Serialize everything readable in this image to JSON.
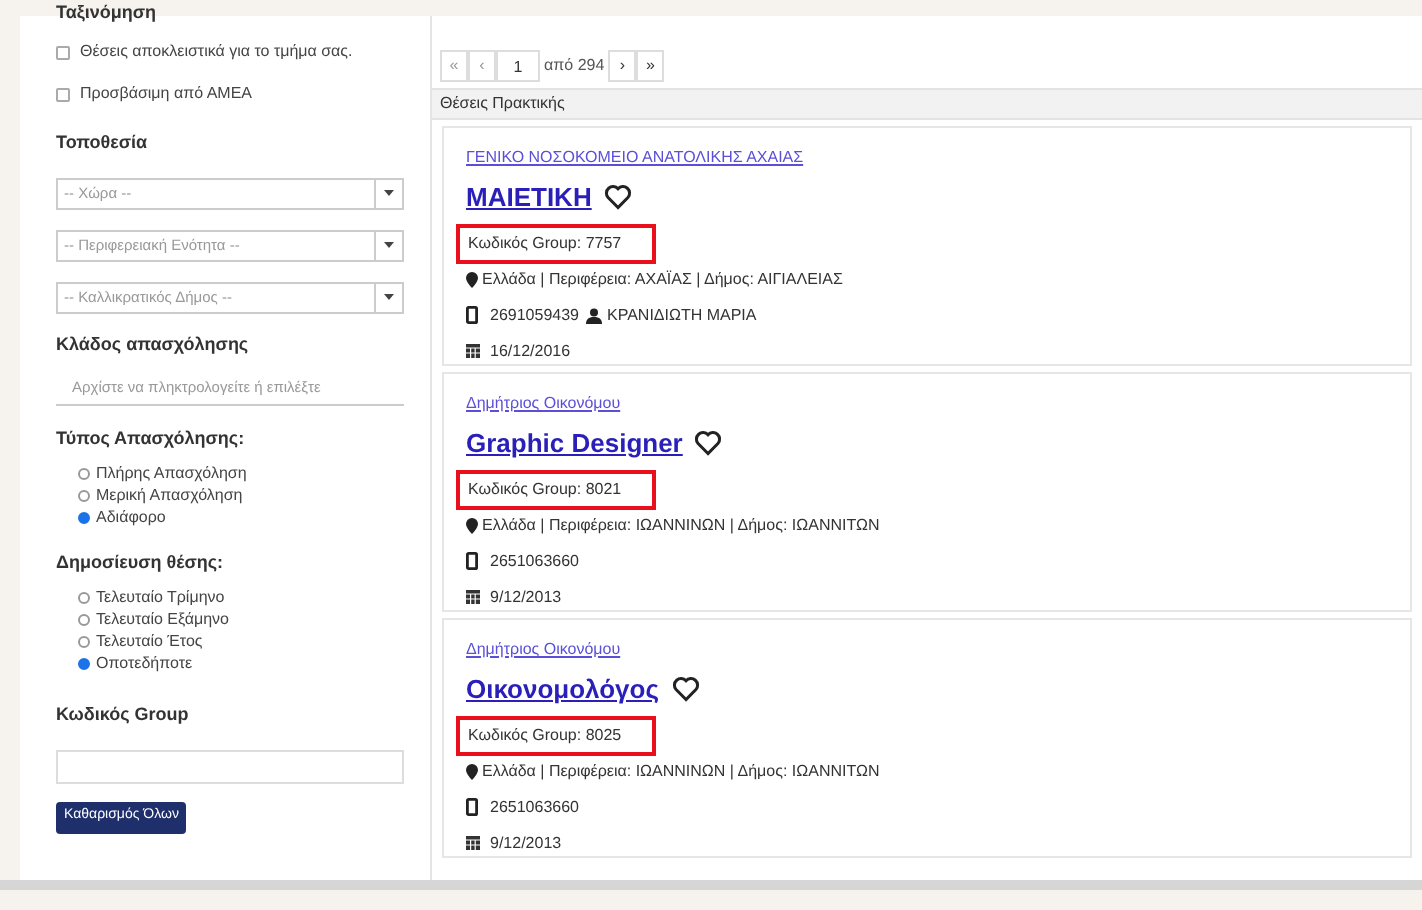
{
  "sidebar": {
    "sort_heading": "Ταξινόμηση",
    "checkboxes": [
      {
        "label": "Θέσεις αποκλειστικά για το τμήμα σας.",
        "checked": false
      },
      {
        "label": "Προσβάσιμη από ΑΜΕΑ",
        "checked": false
      }
    ],
    "location_heading": "Τοποθεσία",
    "selects": [
      {
        "placeholder": "-- Χώρα --"
      },
      {
        "placeholder": "-- Περιφερειακή Ενότητα --"
      },
      {
        "placeholder": "-- Καλλικρατικός Δήμος --"
      }
    ],
    "sector_heading": "Κλάδος απασχόλησης",
    "sector_field": {
      "placeholder": "Αρχίστε να πληκτρολογείτε ή επιλέξτε"
    },
    "radio_groups": [
      {
        "heading": "Τύπος Απασχόλησης:",
        "options": [
          {
            "label": "Πλήρης Απασχόληση",
            "selected": false
          },
          {
            "label": "Μερική Απασχόληση",
            "selected": false
          },
          {
            "label": "Αδιάφορο",
            "selected": true
          }
        ]
      },
      {
        "heading": "Δημοσίευση θέσης:",
        "options": [
          {
            "label": "Τελευταίο Τρίμηνο",
            "selected": false
          },
          {
            "label": "Τελευταίο Εξάμηνο",
            "selected": false
          },
          {
            "label": "Τελευταίο Έτος",
            "selected": false
          },
          {
            "label": "Οποτεδήποτε",
            "selected": true
          }
        ]
      }
    ],
    "group_heading": "Κωδικός Group",
    "clear_button": "Καθαρισμός Όλων"
  },
  "pager": {
    "first": "«",
    "prev": "‹",
    "page": "1",
    "of_total": "από 294",
    "next": "›",
    "last": "»"
  },
  "list_heading": "Θέσεις Πρακτικής",
  "jobs": [
    {
      "org": "ΓΕΝΙΚΟ ΝΟΣΟΚΟΜΕΙΟ ΑΝΑΤΟΛΙΚΗΣ ΑΧΑΙΑΣ",
      "title": "ΜΑΙΕΤΙΚΗ",
      "group_code": "Κωδικός Group: 7757",
      "highlighted": true,
      "location": "Ελλάδα | Περιφέρεια: ΑΧΑΪΑΣ | Δήμος: ΑΙΓΙΑΛΕΙΑΣ",
      "phone": "2691059439",
      "contact": "ΚΡΑΝΙΔΙΩΤΗ ΜΑΡΙΑ",
      "date": "16/12/2016"
    },
    {
      "org": "Δημήτριος Οικονόμου",
      "title": "Graphic Designer",
      "group_code": "Κωδικός Group: 8021",
      "highlighted": true,
      "location": "Ελλάδα | Περιφέρεια: ΙΩΑΝΝΙΝΩΝ | Δήμος: ΙΩΑΝΝΙΤΩΝ",
      "phone": "2651063660",
      "date": "9/12/2013"
    },
    {
      "org": "Δημήτριος Οικονόμου",
      "title": "Οικονομολόγος",
      "group_code": "Κωδικός Group: 8025",
      "highlighted": true,
      "location": "Ελλάδα | Περιφέρεια: ΙΩΑΝΝΙΝΩΝ | Δήμος: ΙΩΑΝΝΙΤΩΝ",
      "phone": "2651063660",
      "date": "9/12/2013"
    }
  ]
}
